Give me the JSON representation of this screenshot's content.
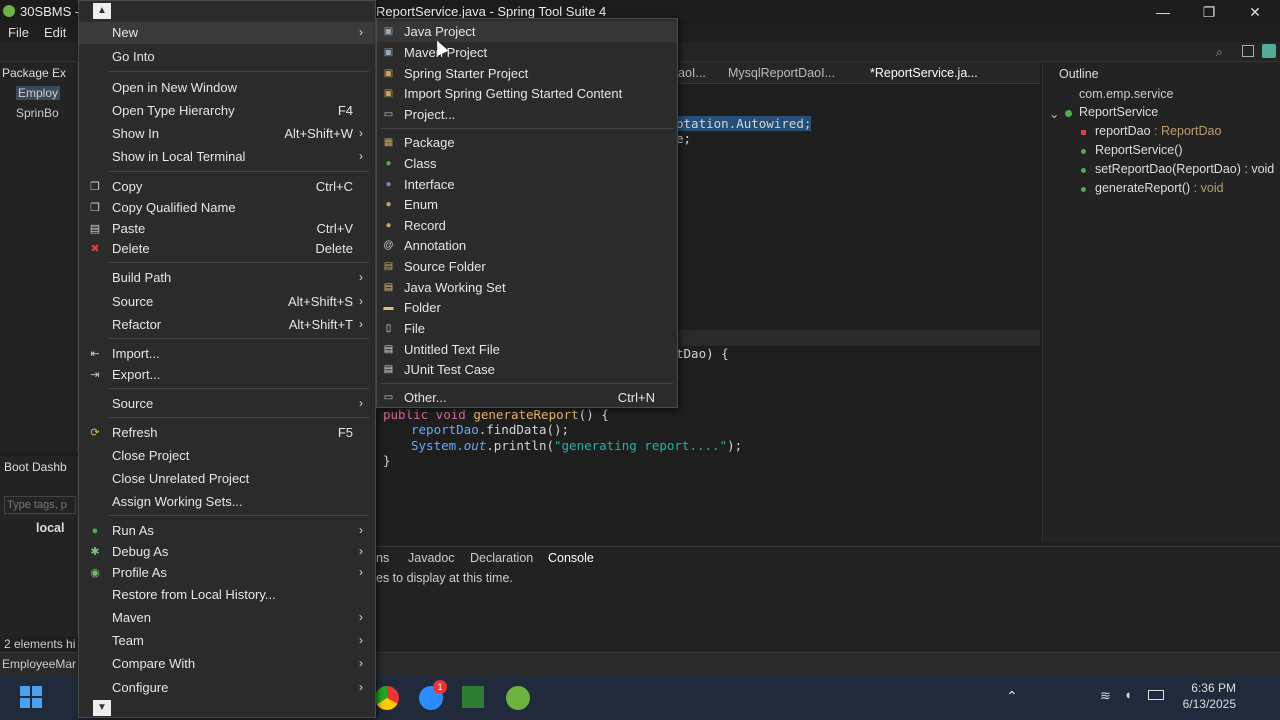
{
  "window": {
    "title_left": "30SBMS -",
    "title_main": "ReportService.java - Spring Tool Suite 4",
    "minimize": "—",
    "restore": "❐",
    "close": "✕"
  },
  "menubar": {
    "file": "File",
    "edit": "Edit"
  },
  "package_explorer": {
    "tab": "Package Ex",
    "items": [
      "Employ",
      "SprinBo"
    ]
  },
  "boot_dashboard": {
    "tab": "Boot Dashb",
    "filter_placeholder": "Type tags, p",
    "local": "local"
  },
  "status_left": "2 elements hi",
  "status_project": "EmployeeMar",
  "editor": {
    "tabs": [
      "aoI...",
      "MysqlReportDaoI...",
      "*ReportService.ja..."
    ],
    "code": {
      "l1": "otation.Autowired;",
      "l2": "e;",
      "l3": "tDao) {",
      "l4_kw": "public void ",
      "l4_fn": "generateReport",
      "l4_rest": "() {",
      "l5_fld": "reportDao",
      "l5_rest": ".findData();",
      "l6_a": "System.",
      "l6_b": "out",
      "l6_c": ".println(",
      "l6_str": "\"generating report....\"",
      "l6_d": ");",
      "l7": "}"
    }
  },
  "outline": {
    "tab": "Outline",
    "package": "com.emp.service",
    "class": "ReportService",
    "members": [
      {
        "name": "reportDao",
        "type": " : ReportDao"
      },
      {
        "name": "ReportService()",
        "type": ""
      },
      {
        "name": "setReportDao(ReportDao) : void",
        "type": ""
      },
      {
        "name": "generateReport()",
        "type": " : void"
      }
    ]
  },
  "console": {
    "tabs": [
      "ns",
      "Javadoc",
      "Declaration",
      "Console"
    ],
    "message": "es to display at this time."
  },
  "context_menu": {
    "items": [
      {
        "label": "New",
        "accel": "",
        "submenu": true
      },
      {
        "label": "Go Into",
        "accel": ""
      },
      {
        "label": "Open in New Window",
        "accel": ""
      },
      {
        "label": "Open Type Hierarchy",
        "accel": "F4"
      },
      {
        "label": "Show In",
        "accel": "Alt+Shift+W",
        "submenu": true
      },
      {
        "label": "Show in Local Terminal",
        "accel": "",
        "submenu": true
      },
      {
        "label": "Copy",
        "accel": "Ctrl+C"
      },
      {
        "label": "Copy Qualified Name",
        "accel": ""
      },
      {
        "label": "Paste",
        "accel": "Ctrl+V"
      },
      {
        "label": "Delete",
        "accel": "Delete"
      },
      {
        "label": "Build Path",
        "accel": "",
        "submenu": true
      },
      {
        "label": "Source",
        "accel": "Alt+Shift+S",
        "submenu": true
      },
      {
        "label": "Refactor",
        "accel": "Alt+Shift+T",
        "submenu": true
      },
      {
        "label": "Import...",
        "accel": ""
      },
      {
        "label": "Export...",
        "accel": ""
      },
      {
        "label": "Source",
        "accel": "",
        "submenu": true
      },
      {
        "label": "Refresh",
        "accel": "F5"
      },
      {
        "label": "Close Project",
        "accel": ""
      },
      {
        "label": "Close Unrelated Project",
        "accel": ""
      },
      {
        "label": "Assign Working Sets...",
        "accel": ""
      },
      {
        "label": "Run As",
        "accel": "",
        "submenu": true
      },
      {
        "label": "Debug As",
        "accel": "",
        "submenu": true
      },
      {
        "label": "Profile As",
        "accel": "",
        "submenu": true
      },
      {
        "label": "Restore from Local History...",
        "accel": ""
      },
      {
        "label": "Maven",
        "accel": "",
        "submenu": true
      },
      {
        "label": "Team",
        "accel": "",
        "submenu": true
      },
      {
        "label": "Compare With",
        "accel": "",
        "submenu": true
      },
      {
        "label": "Configure",
        "accel": "",
        "submenu": true
      }
    ]
  },
  "new_submenu": {
    "items": [
      {
        "label": "Java Project"
      },
      {
        "label": "Maven Project"
      },
      {
        "label": "Spring Starter Project"
      },
      {
        "label": "Import Spring Getting Started Content"
      },
      {
        "label": "Project..."
      },
      {
        "label": "Package"
      },
      {
        "label": "Class"
      },
      {
        "label": "Interface"
      },
      {
        "label": "Enum"
      },
      {
        "label": "Record"
      },
      {
        "label": "Annotation"
      },
      {
        "label": "Source Folder"
      },
      {
        "label": "Java Working Set"
      },
      {
        "label": "Folder"
      },
      {
        "label": "File"
      },
      {
        "label": "Untitled Text File"
      },
      {
        "label": "JUnit Test Case"
      },
      {
        "label": "Other...",
        "accel": "Ctrl+N"
      }
    ]
  },
  "taskbar": {
    "time": "6:36 PM",
    "date": "6/13/2025",
    "zoom_badge": "1"
  }
}
